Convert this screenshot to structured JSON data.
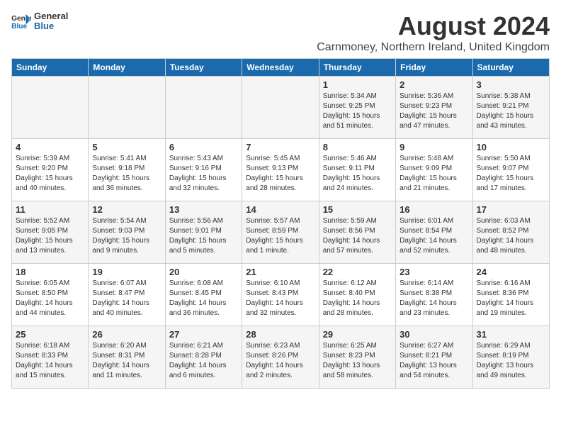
{
  "header": {
    "logo_general": "General",
    "logo_blue": "Blue",
    "title": "August 2024",
    "subtitle": "Carnmoney, Northern Ireland, United Kingdom"
  },
  "columns": [
    "Sunday",
    "Monday",
    "Tuesday",
    "Wednesday",
    "Thursday",
    "Friday",
    "Saturday"
  ],
  "weeks": [
    [
      {
        "day": "",
        "info": ""
      },
      {
        "day": "",
        "info": ""
      },
      {
        "day": "",
        "info": ""
      },
      {
        "day": "",
        "info": ""
      },
      {
        "day": "1",
        "info": "Sunrise: 5:34 AM\nSunset: 9:25 PM\nDaylight: 15 hours\nand 51 minutes."
      },
      {
        "day": "2",
        "info": "Sunrise: 5:36 AM\nSunset: 9:23 PM\nDaylight: 15 hours\nand 47 minutes."
      },
      {
        "day": "3",
        "info": "Sunrise: 5:38 AM\nSunset: 9:21 PM\nDaylight: 15 hours\nand 43 minutes."
      }
    ],
    [
      {
        "day": "4",
        "info": "Sunrise: 5:39 AM\nSunset: 9:20 PM\nDaylight: 15 hours\nand 40 minutes."
      },
      {
        "day": "5",
        "info": "Sunrise: 5:41 AM\nSunset: 9:18 PM\nDaylight: 15 hours\nand 36 minutes."
      },
      {
        "day": "6",
        "info": "Sunrise: 5:43 AM\nSunset: 9:16 PM\nDaylight: 15 hours\nand 32 minutes."
      },
      {
        "day": "7",
        "info": "Sunrise: 5:45 AM\nSunset: 9:13 PM\nDaylight: 15 hours\nand 28 minutes."
      },
      {
        "day": "8",
        "info": "Sunrise: 5:46 AM\nSunset: 9:11 PM\nDaylight: 15 hours\nand 24 minutes."
      },
      {
        "day": "9",
        "info": "Sunrise: 5:48 AM\nSunset: 9:09 PM\nDaylight: 15 hours\nand 21 minutes."
      },
      {
        "day": "10",
        "info": "Sunrise: 5:50 AM\nSunset: 9:07 PM\nDaylight: 15 hours\nand 17 minutes."
      }
    ],
    [
      {
        "day": "11",
        "info": "Sunrise: 5:52 AM\nSunset: 9:05 PM\nDaylight: 15 hours\nand 13 minutes."
      },
      {
        "day": "12",
        "info": "Sunrise: 5:54 AM\nSunset: 9:03 PM\nDaylight: 15 hours\nand 9 minutes."
      },
      {
        "day": "13",
        "info": "Sunrise: 5:56 AM\nSunset: 9:01 PM\nDaylight: 15 hours\nand 5 minutes."
      },
      {
        "day": "14",
        "info": "Sunrise: 5:57 AM\nSunset: 8:59 PM\nDaylight: 15 hours\nand 1 minute."
      },
      {
        "day": "15",
        "info": "Sunrise: 5:59 AM\nSunset: 8:56 PM\nDaylight: 14 hours\nand 57 minutes."
      },
      {
        "day": "16",
        "info": "Sunrise: 6:01 AM\nSunset: 8:54 PM\nDaylight: 14 hours\nand 52 minutes."
      },
      {
        "day": "17",
        "info": "Sunrise: 6:03 AM\nSunset: 8:52 PM\nDaylight: 14 hours\nand 48 minutes."
      }
    ],
    [
      {
        "day": "18",
        "info": "Sunrise: 6:05 AM\nSunset: 8:50 PM\nDaylight: 14 hours\nand 44 minutes."
      },
      {
        "day": "19",
        "info": "Sunrise: 6:07 AM\nSunset: 8:47 PM\nDaylight: 14 hours\nand 40 minutes."
      },
      {
        "day": "20",
        "info": "Sunrise: 6:08 AM\nSunset: 8:45 PM\nDaylight: 14 hours\nand 36 minutes."
      },
      {
        "day": "21",
        "info": "Sunrise: 6:10 AM\nSunset: 8:43 PM\nDaylight: 14 hours\nand 32 minutes."
      },
      {
        "day": "22",
        "info": "Sunrise: 6:12 AM\nSunset: 8:40 PM\nDaylight: 14 hours\nand 28 minutes."
      },
      {
        "day": "23",
        "info": "Sunrise: 6:14 AM\nSunset: 8:38 PM\nDaylight: 14 hours\nand 23 minutes."
      },
      {
        "day": "24",
        "info": "Sunrise: 6:16 AM\nSunset: 8:36 PM\nDaylight: 14 hours\nand 19 minutes."
      }
    ],
    [
      {
        "day": "25",
        "info": "Sunrise: 6:18 AM\nSunset: 8:33 PM\nDaylight: 14 hours\nand 15 minutes."
      },
      {
        "day": "26",
        "info": "Sunrise: 6:20 AM\nSunset: 8:31 PM\nDaylight: 14 hours\nand 11 minutes."
      },
      {
        "day": "27",
        "info": "Sunrise: 6:21 AM\nSunset: 8:28 PM\nDaylight: 14 hours\nand 6 minutes."
      },
      {
        "day": "28",
        "info": "Sunrise: 6:23 AM\nSunset: 8:26 PM\nDaylight: 14 hours\nand 2 minutes."
      },
      {
        "day": "29",
        "info": "Sunrise: 6:25 AM\nSunset: 8:23 PM\nDaylight: 13 hours\nand 58 minutes."
      },
      {
        "day": "30",
        "info": "Sunrise: 6:27 AM\nSunset: 8:21 PM\nDaylight: 13 hours\nand 54 minutes."
      },
      {
        "day": "31",
        "info": "Sunrise: 6:29 AM\nSunset: 8:19 PM\nDaylight: 13 hours\nand 49 minutes."
      }
    ]
  ]
}
